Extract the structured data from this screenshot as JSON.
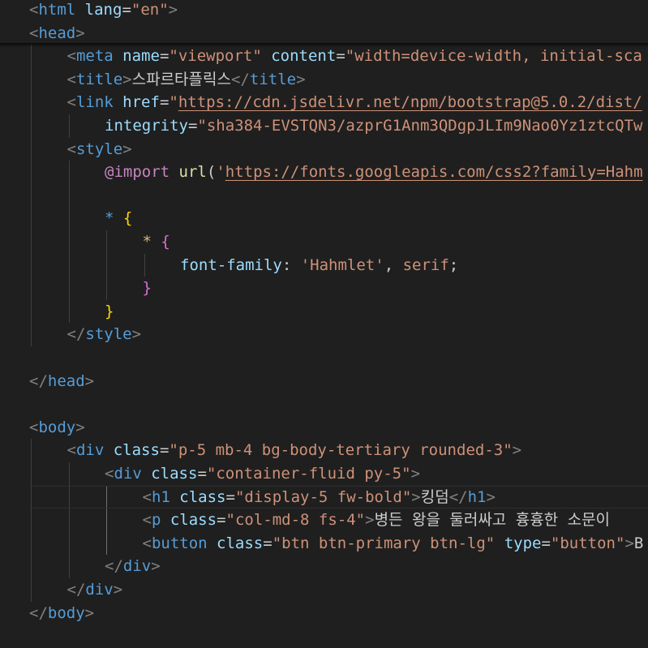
{
  "colors": {
    "background": "#1f1f1f",
    "punctuation": "#808080",
    "tag": "#569cd6",
    "attribute": "#9cdcfe",
    "string": "#ce9178",
    "text": "#cccccc",
    "css_property": "#9cdcfe",
    "at_rule": "#c586c0",
    "css_function": "#dcdcaa",
    "brace_1": "#ffd700",
    "brace_2": "#da70d6",
    "selector": "#d7ba7d"
  },
  "lines": [
    [
      [
        "<",
        "punctuation"
      ],
      [
        "html",
        "tag"
      ],
      [
        " ",
        "text"
      ],
      [
        "lang",
        "attribute"
      ],
      [
        "=",
        "text"
      ],
      [
        "\"en\"",
        "string"
      ],
      [
        ">",
        "punctuation"
      ]
    ],
    [
      [
        "<",
        "punctuation"
      ],
      [
        "head",
        "tag"
      ],
      [
        ">",
        "punctuation"
      ]
    ],
    [
      [
        "<",
        "punctuation"
      ],
      [
        "meta",
        "tag"
      ],
      [
        " ",
        "text"
      ],
      [
        "name",
        "attribute"
      ],
      [
        "=",
        "text"
      ],
      [
        "\"viewport\"",
        "string"
      ],
      [
        " ",
        "text"
      ],
      [
        "content",
        "attribute"
      ],
      [
        "=",
        "text"
      ],
      [
        "\"width=device-width, initial-sca",
        "string"
      ]
    ],
    [
      [
        "<",
        "punctuation"
      ],
      [
        "title",
        "tag"
      ],
      [
        ">",
        "punctuation"
      ],
      [
        "스파르타플릭스",
        "text"
      ],
      [
        "</",
        "punctuation"
      ],
      [
        "title",
        "tag"
      ],
      [
        ">",
        "punctuation"
      ]
    ],
    [
      [
        "<",
        "punctuation"
      ],
      [
        "link",
        "tag"
      ],
      [
        " ",
        "text"
      ],
      [
        "href",
        "attribute"
      ],
      [
        "=",
        "text"
      ],
      [
        "\"",
        "string"
      ],
      [
        "https://cdn.jsdelivr.net/npm/bootstrap@5.0.2/dist/",
        "url"
      ]
    ],
    [
      [
        "integrity",
        "attribute"
      ],
      [
        "=",
        "text"
      ],
      [
        "\"sha384-EVSTQN3/azprG1Anm3QDgpJLIm9Nao0Yz1ztcQTw",
        "string"
      ]
    ],
    [
      [
        "<",
        "punctuation"
      ],
      [
        "style",
        "tag"
      ],
      [
        ">",
        "punctuation"
      ]
    ],
    [
      [
        "@import",
        "at_rule"
      ],
      [
        " ",
        "text"
      ],
      [
        "url",
        "css_function"
      ],
      [
        "(",
        "text"
      ],
      [
        "'",
        "string"
      ],
      [
        "https://fonts.googleapis.com/css2?family=Hahm",
        "url"
      ]
    ],
    [],
    [
      [
        "*",
        "tag"
      ],
      [
        " ",
        "text"
      ],
      [
        "{",
        "brace_1"
      ]
    ],
    [
      [
        "*",
        "selector"
      ],
      [
        " ",
        "text"
      ],
      [
        "{",
        "brace_2"
      ]
    ],
    [
      [
        "font-family",
        "css_property"
      ],
      [
        ": ",
        "text"
      ],
      [
        "'Hahmlet'",
        "string"
      ],
      [
        ", ",
        "text"
      ],
      [
        "serif",
        "string"
      ],
      [
        ";",
        "text"
      ]
    ],
    [
      [
        "}",
        "brace_2"
      ]
    ],
    [
      [
        "}",
        "brace_1"
      ]
    ],
    [
      [
        "</",
        "punctuation"
      ],
      [
        "style",
        "tag"
      ],
      [
        ">",
        "punctuation"
      ]
    ],
    [],
    [
      [
        "</",
        "punctuation"
      ],
      [
        "head",
        "tag"
      ],
      [
        ">",
        "punctuation"
      ]
    ],
    [],
    [
      [
        "<",
        "punctuation"
      ],
      [
        "body",
        "tag"
      ],
      [
        ">",
        "punctuation"
      ]
    ],
    [
      [
        "<",
        "punctuation"
      ],
      [
        "div",
        "tag"
      ],
      [
        " ",
        "text"
      ],
      [
        "class",
        "attribute"
      ],
      [
        "=",
        "text"
      ],
      [
        "\"p-5 mb-4 bg-body-tertiary rounded-3\"",
        "string"
      ],
      [
        ">",
        "punctuation"
      ]
    ],
    [
      [
        "<",
        "punctuation"
      ],
      [
        "div",
        "tag"
      ],
      [
        " ",
        "text"
      ],
      [
        "class",
        "attribute"
      ],
      [
        "=",
        "text"
      ],
      [
        "\"container-fluid py-5\"",
        "string"
      ],
      [
        ">",
        "punctuation"
      ]
    ],
    [
      [
        "<",
        "punctuation"
      ],
      [
        "h1",
        "tag"
      ],
      [
        " ",
        "text"
      ],
      [
        "class",
        "attribute"
      ],
      [
        "=",
        "text"
      ],
      [
        "\"display-5 fw-bold\"",
        "string"
      ],
      [
        ">",
        "punctuation"
      ],
      [
        "킹덤",
        "text"
      ],
      [
        "</",
        "punctuation"
      ],
      [
        "h1",
        "tag"
      ],
      [
        ">",
        "punctuation"
      ]
    ],
    [
      [
        "<",
        "punctuation"
      ],
      [
        "p",
        "tag"
      ],
      [
        " ",
        "text"
      ],
      [
        "class",
        "attribute"
      ],
      [
        "=",
        "text"
      ],
      [
        "\"col-md-8 fs-4\"",
        "string"
      ],
      [
        ">",
        "punctuation"
      ],
      [
        "병든 왕을 둘러싸고 흉흉한 소문이",
        "text"
      ]
    ],
    [
      [
        "<",
        "punctuation"
      ],
      [
        "button",
        "tag"
      ],
      [
        " ",
        "text"
      ],
      [
        "class",
        "attribute"
      ],
      [
        "=",
        "text"
      ],
      [
        "\"btn btn-primary btn-lg\"",
        "string"
      ],
      [
        " ",
        "text"
      ],
      [
        "type",
        "attribute"
      ],
      [
        "=",
        "text"
      ],
      [
        "\"button\"",
        "string"
      ],
      [
        ">",
        "punctuation"
      ],
      [
        "B",
        "text"
      ]
    ],
    [
      [
        "</",
        "punctuation"
      ],
      [
        "div",
        "tag"
      ],
      [
        ">",
        "punctuation"
      ]
    ],
    [
      [
        "</",
        "punctuation"
      ],
      [
        "div",
        "tag"
      ],
      [
        ">",
        "punctuation"
      ]
    ],
    [
      [
        "</",
        "punctuation"
      ],
      [
        "body",
        "tag"
      ],
      [
        ">",
        "punctuation"
      ]
    ],
    [],
    [
      [
        "</",
        "punctuation"
      ],
      [
        "html",
        "tag"
      ],
      [
        ">",
        "punctuation"
      ]
    ]
  ]
}
